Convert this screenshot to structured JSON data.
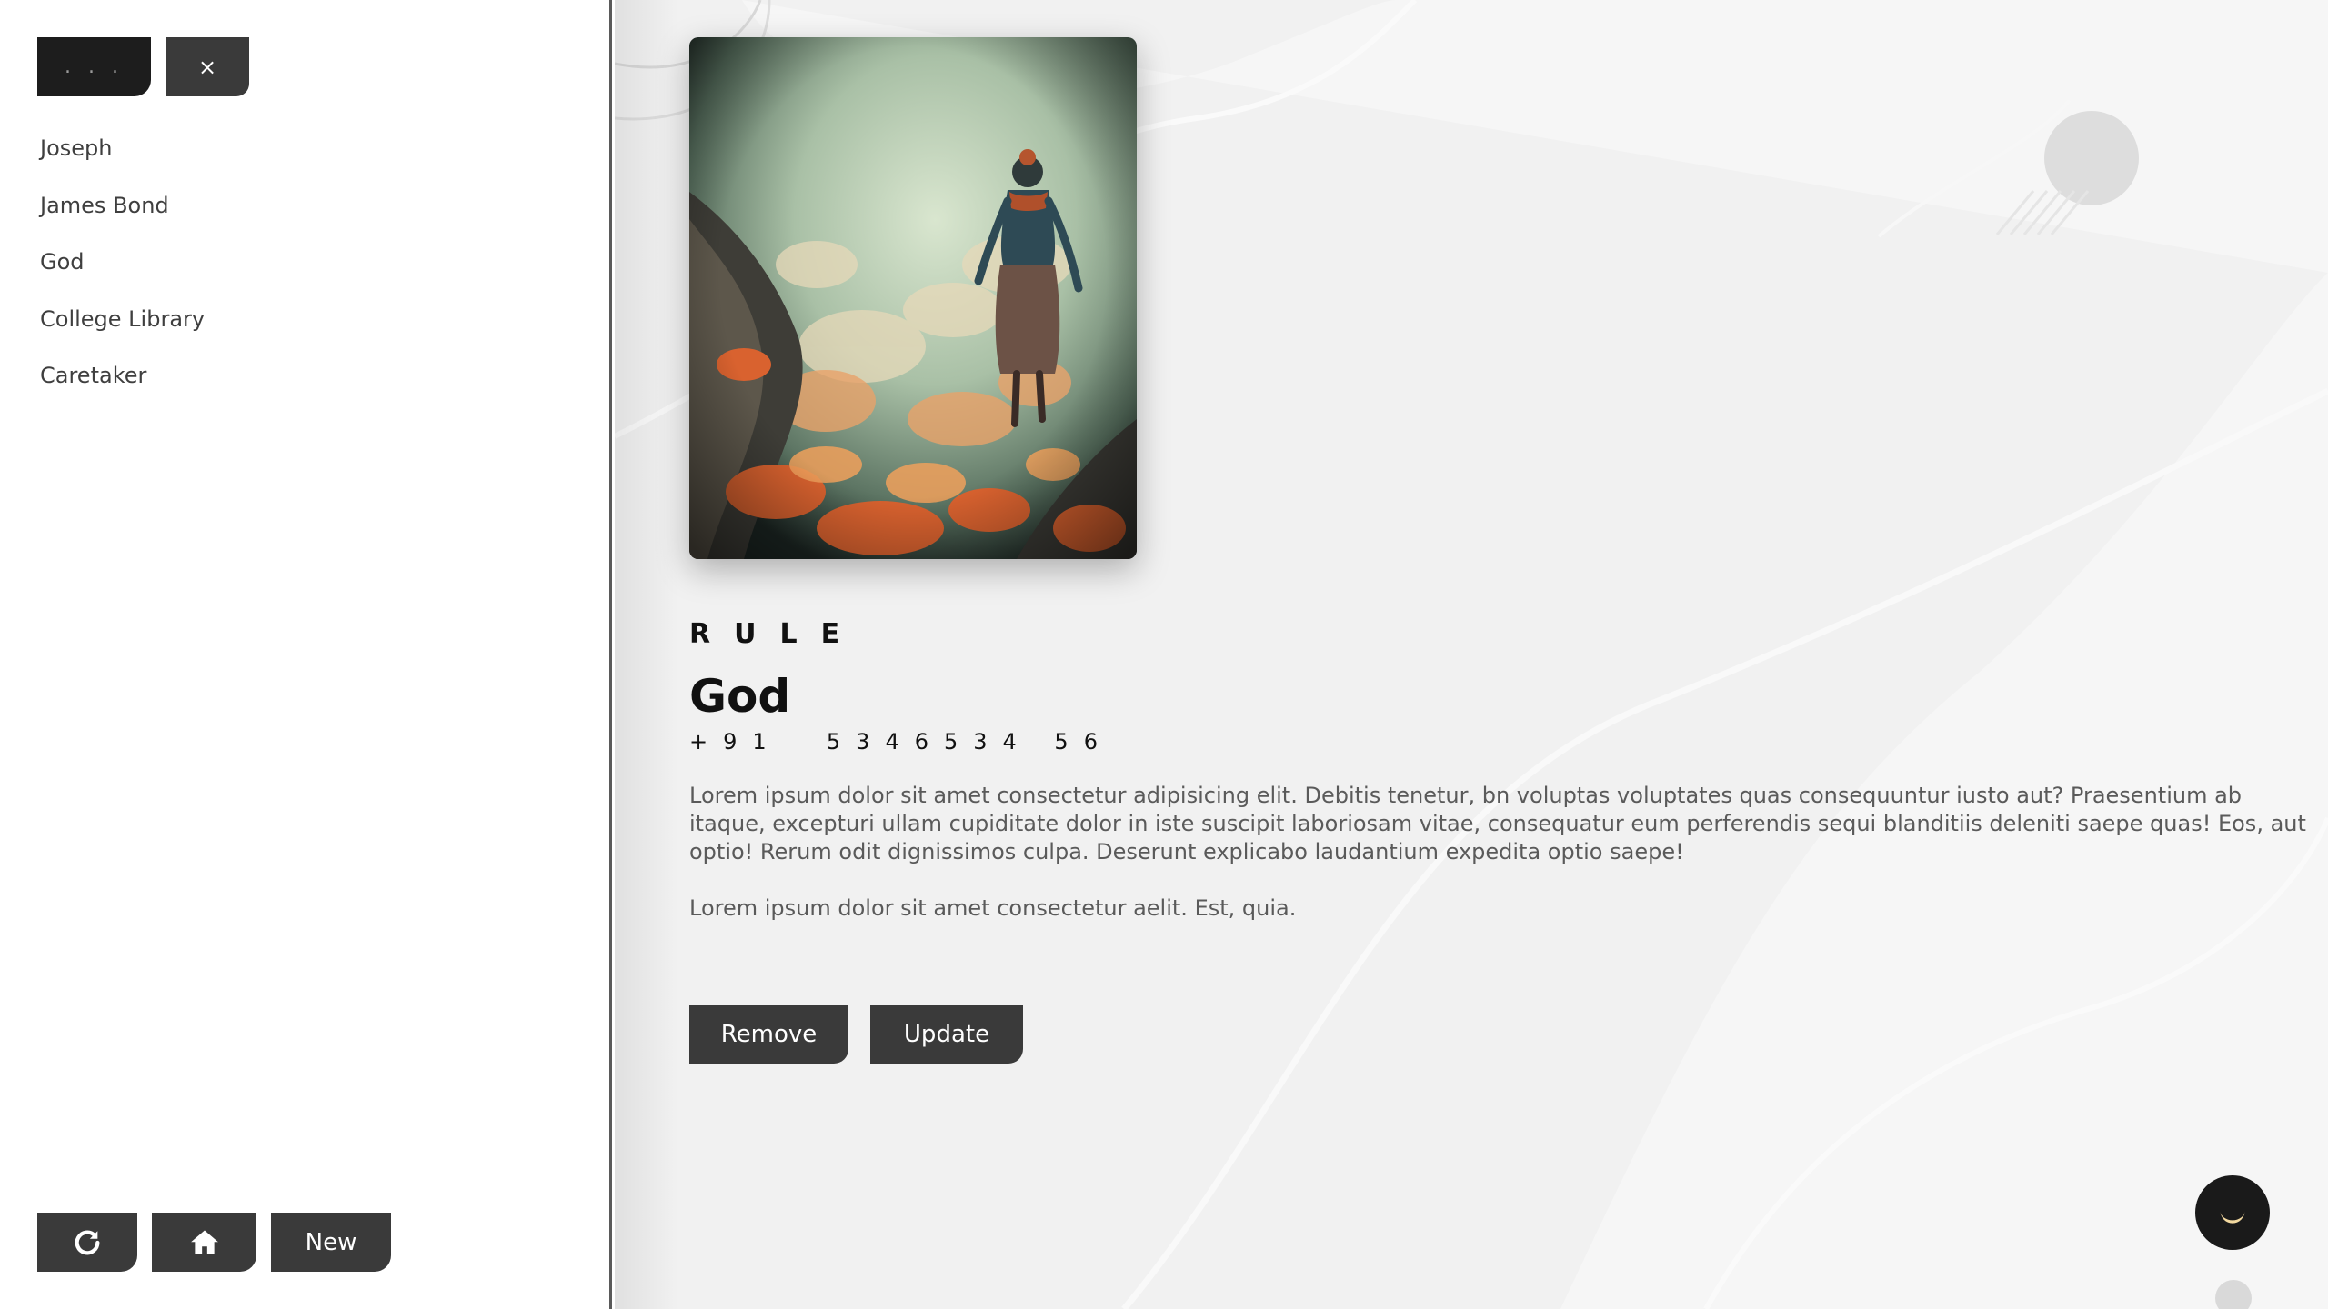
{
  "sidebar": {
    "search_button_label": ". . .",
    "close_button_label": "×",
    "contacts": [
      {
        "name": "Joseph"
      },
      {
        "name": "James Bond"
      },
      {
        "name": "God"
      },
      {
        "name": "College Library"
      },
      {
        "name": "Caretaker"
      }
    ],
    "bottom_buttons": {
      "refresh_icon": "refresh-icon",
      "home_icon": "home-icon",
      "new_label": "New"
    }
  },
  "contact": {
    "category": "RULE",
    "name": "God",
    "phone": "+91  5346534 56",
    "description": "Lorem ipsum dolor sit amet consectetur adipisicing elit. Debitis tenetur, bn voluptas voluptates quas consequuntur iusto aut? Praesentium ab itaque, excepturi ullam cupiditate dolor in iste suscipit laboriosam vitae, consequatur eum perferendis sequi blanditiis deleniti saepe quas! Eos, aut optio! Rerum odit dignissimos culpa. Deserunt explicabo laudantium expedita optio saepe!",
    "note": "Lorem ipsum dolor sit amet consectetur aelit. Est, quia.",
    "remove_label": "Remove",
    "update_label": "Update"
  },
  "theme_toggle_icon": "moon-icon",
  "colors": {
    "dark_button": "#3a3a3a",
    "darker_button": "#1d1d1d",
    "main_bg": "#f1f1f1",
    "moon": "#f3d9a0"
  }
}
